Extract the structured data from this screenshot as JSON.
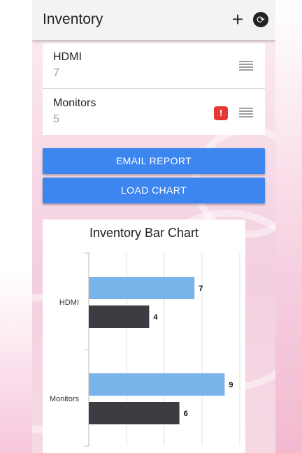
{
  "app": {
    "title": "Inventory"
  },
  "toolbar": {
    "add_icon": "plus-icon",
    "add_glyph": "+",
    "refresh_icon": "refresh-icon",
    "refresh_glyph": "⟳"
  },
  "inventory_items": [
    {
      "name": "HDMI",
      "quantity": "7",
      "warning": false
    },
    {
      "name": "Monitors",
      "quantity": "5",
      "warning": true,
      "warning_glyph": "!"
    }
  ],
  "buttons": {
    "email_report": "EMAIL REPORT",
    "load_chart": "LOAD CHART"
  },
  "colors": {
    "primary_button": "#3d86f0",
    "warning": "#e53935",
    "bar_series_1": "#7ab3ea",
    "bar_series_2": "#3c3c42"
  },
  "chart_data": {
    "type": "bar",
    "orientation": "horizontal",
    "title": "Inventory Bar Chart",
    "categories": [
      "HDMI",
      "Monitors"
    ],
    "series": [
      {
        "values": [
          7,
          9
        ]
      },
      {
        "values": [
          4,
          6
        ]
      }
    ],
    "xlim": [
      0,
      10
    ],
    "grid": true,
    "data_labels": true
  }
}
